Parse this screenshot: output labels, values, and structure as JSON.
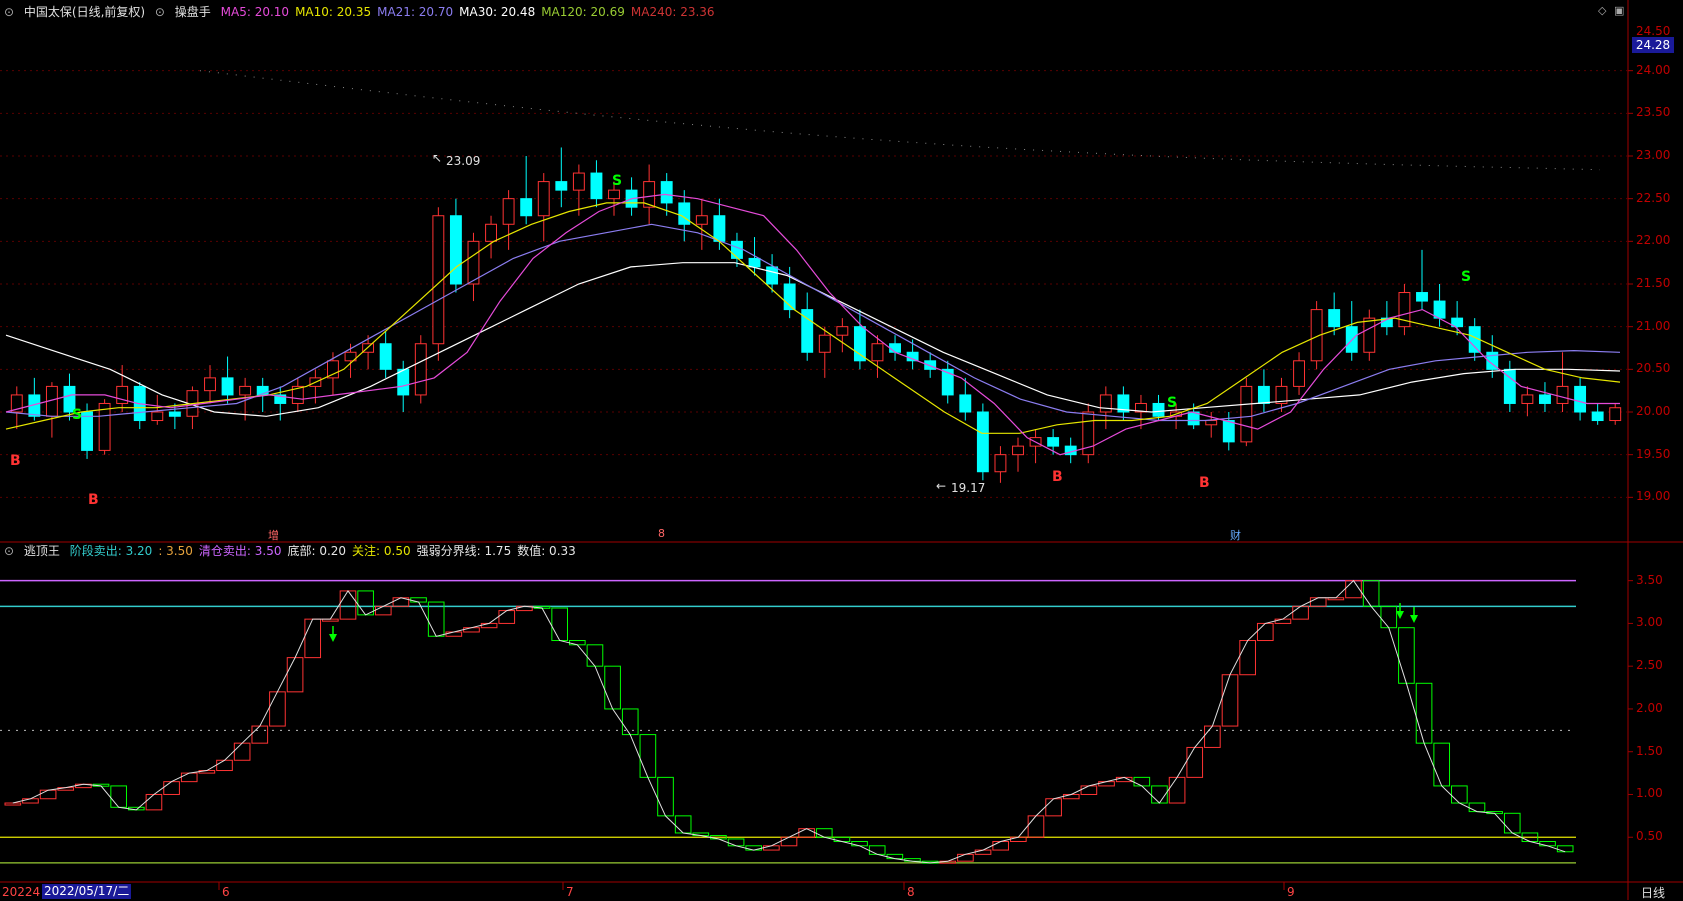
{
  "colors": {
    "up": "#ff3333",
    "down": "#00ffff",
    "green": "#00ff00",
    "grid": "#5a0000",
    "axis": "#a00000",
    "ma5": "#e54bd9",
    "ma10": "#e6e600",
    "ma21": "#8b7df0",
    "ma30": "#ffffff",
    "ma120": "#99cc33",
    "ma240": "#cc3333",
    "purple_line": "#cc66ff",
    "cyan_line": "#33cccc",
    "yellow_line": "#e6e600"
  },
  "header": {
    "icon": "collapse-icon",
    "title": "中国太保(日线,前复权)",
    "indicator_icon": "collapse-icon",
    "indicator_name": "操盘手",
    "ma": [
      {
        "label": "MA5: 20.10",
        "color": "#e54bd9"
      },
      {
        "label": "MA10: 20.35",
        "color": "#e6e600"
      },
      {
        "label": "MA21: 20.70",
        "color": "#8b7df0"
      },
      {
        "label": "MA30: 20.48",
        "color": "#ffffff"
      },
      {
        "label": "MA120: 20.69",
        "color": "#99cc33"
      },
      {
        "label": "MA240: 23.36",
        "color": "#cc3333"
      }
    ]
  },
  "sub_header": {
    "name": "逃顶王",
    "items": [
      {
        "label": "阶段卖出: 3.20",
        "color": "#33cccc"
      },
      {
        "label": ": 3.50",
        "color": "#e6a23c"
      },
      {
        "label": "清仓卖出: 3.50",
        "color": "#cc66ff"
      },
      {
        "label": "底部: 0.20",
        "color": "#e6e6e6"
      },
      {
        "label": "关注: 0.50",
        "color": "#e6e600"
      },
      {
        "label": "强弱分界线: 1.75",
        "color": "#e6e6e6"
      },
      {
        "label": "数值: 0.33",
        "color": "#e6e6e6"
      }
    ]
  },
  "price_axis": {
    "current": "24.28",
    "top_label": "24.50",
    "ticks": [
      "24.00",
      "23.50",
      "23.00",
      "22.50",
      "22.00",
      "21.50",
      "21.00",
      "20.50",
      "20.00",
      "19.50",
      "19.00"
    ]
  },
  "indicator_axis": {
    "ticks": [
      "3.50",
      "3.00",
      "2.50",
      "2.00",
      "1.50",
      "1.00",
      "0.50"
    ]
  },
  "annotations": {
    "high": "23.09",
    "low": "19.17"
  },
  "signals": [
    {
      "text": "B",
      "x": 10,
      "y": 462,
      "color": "#ff3333"
    },
    {
      "text": "B",
      "x": 88,
      "y": 501,
      "color": "#ff3333"
    },
    {
      "text": "S",
      "x": 72,
      "y": 416,
      "color": "#00ff00"
    },
    {
      "text": "S",
      "x": 612,
      "y": 182,
      "color": "#00ff00"
    },
    {
      "text": "B",
      "x": 1052,
      "y": 478,
      "color": "#ff3333"
    },
    {
      "text": "S",
      "x": 1167,
      "y": 404,
      "color": "#00ff00"
    },
    {
      "text": "B",
      "x": 1199,
      "y": 484,
      "color": "#ff3333"
    },
    {
      "text": "S",
      "x": 1461,
      "y": 278,
      "color": "#00ff00"
    }
  ],
  "events": [
    {
      "text": "增",
      "x": 268
    },
    {
      "text": "8",
      "x": 658
    },
    {
      "text": "财",
      "x": 1230
    }
  ],
  "time_axis": {
    "start": "20224",
    "cursor": "2022/05/17/二",
    "months": [
      {
        "text": "6",
        "x": 222
      },
      {
        "text": "7",
        "x": 566
      },
      {
        "text": "8",
        "x": 907
      },
      {
        "text": "9",
        "x": 1287
      }
    ]
  },
  "footer": {
    "period": "日线"
  },
  "chart_data": {
    "type": "candlestick",
    "x_months": [
      "6",
      "7",
      "8",
      "9"
    ],
    "ylim": [
      18.5,
      24.5
    ],
    "candles_ohlc": [
      [
        20.0,
        20.3,
        19.8,
        20.2
      ],
      [
        20.2,
        20.4,
        19.9,
        19.95
      ],
      [
        19.95,
        20.35,
        19.7,
        20.3
      ],
      [
        20.3,
        20.45,
        19.9,
        20.0
      ],
      [
        20.0,
        20.1,
        19.45,
        19.55
      ],
      [
        19.55,
        20.15,
        19.5,
        20.1
      ],
      [
        20.1,
        20.55,
        20.0,
        20.3
      ],
      [
        20.3,
        20.35,
        19.8,
        19.9
      ],
      [
        19.9,
        20.2,
        19.85,
        20.0
      ],
      [
        20.0,
        20.1,
        19.8,
        19.95
      ],
      [
        19.95,
        20.3,
        19.8,
        20.25
      ],
      [
        20.25,
        20.55,
        20.1,
        20.4
      ],
      [
        20.4,
        20.65,
        20.1,
        20.2
      ],
      [
        20.2,
        20.4,
        19.9,
        20.3
      ],
      [
        20.3,
        20.4,
        20.0,
        20.2
      ],
      [
        20.2,
        20.3,
        19.9,
        20.1
      ],
      [
        20.1,
        20.4,
        20.0,
        20.3
      ],
      [
        20.3,
        20.5,
        20.1,
        20.4
      ],
      [
        20.4,
        20.7,
        20.2,
        20.6
      ],
      [
        20.6,
        20.8,
        20.4,
        20.7
      ],
      [
        20.7,
        20.9,
        20.5,
        20.8
      ],
      [
        20.8,
        20.95,
        20.4,
        20.5
      ],
      [
        20.5,
        20.6,
        20.0,
        20.2
      ],
      [
        20.2,
        20.9,
        20.1,
        20.8
      ],
      [
        20.8,
        22.4,
        20.6,
        22.3
      ],
      [
        22.3,
        22.5,
        21.4,
        21.5
      ],
      [
        21.5,
        22.1,
        21.3,
        22.0
      ],
      [
        22.0,
        22.3,
        21.8,
        22.2
      ],
      [
        22.2,
        22.6,
        21.9,
        22.5
      ],
      [
        22.5,
        23.0,
        22.2,
        22.3
      ],
      [
        22.3,
        22.8,
        22.0,
        22.7
      ],
      [
        22.7,
        23.1,
        22.4,
        22.6
      ],
      [
        22.6,
        22.9,
        22.3,
        22.8
      ],
      [
        22.8,
        22.95,
        22.4,
        22.5
      ],
      [
        22.5,
        22.7,
        22.3,
        22.6
      ],
      [
        22.6,
        22.75,
        22.3,
        22.4
      ],
      [
        22.4,
        22.9,
        22.2,
        22.7
      ],
      [
        22.7,
        22.8,
        22.3,
        22.45
      ],
      [
        22.45,
        22.6,
        22.0,
        22.2
      ],
      [
        22.2,
        22.5,
        21.9,
        22.3
      ],
      [
        22.3,
        22.5,
        21.9,
        22.0
      ],
      [
        22.0,
        22.1,
        21.7,
        21.8
      ],
      [
        21.8,
        22.05,
        21.6,
        21.7
      ],
      [
        21.7,
        21.85,
        21.4,
        21.5
      ],
      [
        21.5,
        21.7,
        21.1,
        21.2
      ],
      [
        21.2,
        21.4,
        20.6,
        20.7
      ],
      [
        20.7,
        21.0,
        20.4,
        20.9
      ],
      [
        20.9,
        21.1,
        20.7,
        21.0
      ],
      [
        21.0,
        21.2,
        20.5,
        20.6
      ],
      [
        20.6,
        20.9,
        20.4,
        20.8
      ],
      [
        20.8,
        20.9,
        20.6,
        20.7
      ],
      [
        20.7,
        20.85,
        20.5,
        20.6
      ],
      [
        20.6,
        20.7,
        20.4,
        20.5
      ],
      [
        20.5,
        20.6,
        20.1,
        20.2
      ],
      [
        20.2,
        20.4,
        19.9,
        20.0
      ],
      [
        20.0,
        20.1,
        19.2,
        19.3
      ],
      [
        19.3,
        19.6,
        19.17,
        19.5
      ],
      [
        19.5,
        19.7,
        19.3,
        19.6
      ],
      [
        19.6,
        19.8,
        19.4,
        19.7
      ],
      [
        19.7,
        19.8,
        19.5,
        19.6
      ],
      [
        19.6,
        19.7,
        19.4,
        19.5
      ],
      [
        19.5,
        20.1,
        19.4,
        20.0
      ],
      [
        20.0,
        20.3,
        19.8,
        20.2
      ],
      [
        20.2,
        20.3,
        19.9,
        20.0
      ],
      [
        20.0,
        20.2,
        19.8,
        20.1
      ],
      [
        20.1,
        20.2,
        19.9,
        19.95
      ],
      [
        19.95,
        20.1,
        19.8,
        20.0
      ],
      [
        20.0,
        20.1,
        19.8,
        19.85
      ],
      [
        19.85,
        20.0,
        19.7,
        19.9
      ],
      [
        19.9,
        20.0,
        19.55,
        19.65
      ],
      [
        19.65,
        20.4,
        19.6,
        20.3
      ],
      [
        20.3,
        20.5,
        20.0,
        20.1
      ],
      [
        20.1,
        20.4,
        20.0,
        20.3
      ],
      [
        20.3,
        20.7,
        20.2,
        20.6
      ],
      [
        20.6,
        21.3,
        20.5,
        21.2
      ],
      [
        21.2,
        21.4,
        20.9,
        21.0
      ],
      [
        21.0,
        21.3,
        20.6,
        20.7
      ],
      [
        20.7,
        21.2,
        20.6,
        21.1
      ],
      [
        21.1,
        21.3,
        20.9,
        21.0
      ],
      [
        21.0,
        21.5,
        20.9,
        21.4
      ],
      [
        21.4,
        21.9,
        21.2,
        21.3
      ],
      [
        21.3,
        21.5,
        21.0,
        21.1
      ],
      [
        21.1,
        21.3,
        20.9,
        21.0
      ],
      [
        21.0,
        21.1,
        20.6,
        20.7
      ],
      [
        20.7,
        20.9,
        20.4,
        20.5
      ],
      [
        20.5,
        20.6,
        20.0,
        20.1
      ],
      [
        20.1,
        20.3,
        19.95,
        20.2
      ],
      [
        20.2,
        20.35,
        20.0,
        20.1
      ],
      [
        20.1,
        20.7,
        20.0,
        20.3
      ],
      [
        20.3,
        20.4,
        19.9,
        20.0
      ],
      [
        20.0,
        20.1,
        19.85,
        19.9
      ],
      [
        19.9,
        20.1,
        19.85,
        20.05
      ]
    ],
    "indicator_values": [
      0.9,
      0.95,
      1.05,
      1.08,
      1.12,
      1.1,
      0.85,
      0.82,
      1.0,
      1.15,
      1.25,
      1.28,
      1.4,
      1.6,
      1.8,
      2.2,
      2.6,
      3.05,
      3.05,
      3.38,
      3.1,
      3.2,
      3.3,
      3.25,
      2.85,
      2.9,
      2.95,
      3.0,
      3.15,
      3.2,
      3.18,
      2.8,
      2.75,
      2.5,
      2.0,
      1.7,
      1.2,
      0.75,
      0.55,
      0.52,
      0.48,
      0.4,
      0.35,
      0.4,
      0.5,
      0.6,
      0.5,
      0.45,
      0.4,
      0.3,
      0.25,
      0.22,
      0.2,
      0.22,
      0.3,
      0.35,
      0.45,
      0.5,
      0.75,
      0.95,
      1.0,
      1.1,
      1.15,
      1.2,
      1.1,
      0.9,
      1.2,
      1.55,
      1.8,
      2.4,
      2.8,
      3.0,
      3.05,
      3.2,
      3.3,
      3.3,
      3.5,
      3.2,
      2.95,
      2.3,
      1.6,
      1.1,
      0.9,
      0.8,
      0.78,
      0.55,
      0.45,
      0.4,
      0.33
    ],
    "ma_series": [
      {
        "name": "MA5",
        "values": [
          20.0,
          20.1,
          20.2,
          20.2,
          20.1,
          20.05,
          20.1,
          20.15,
          20.2,
          20.15,
          20.2,
          20.25,
          20.3,
          20.4,
          20.7,
          21.3,
          21.8,
          22.1,
          22.35,
          22.5,
          22.55,
          22.5,
          22.4,
          22.3,
          21.9,
          21.4,
          21.0,
          20.7,
          20.55,
          20.4,
          20.1,
          19.7,
          19.5,
          19.6,
          19.8,
          19.9,
          20.0,
          19.9,
          19.8,
          20.0,
          20.5,
          20.9,
          21.1,
          21.2,
          21.0,
          20.6,
          20.3,
          20.2,
          20.1,
          20.1
        ]
      },
      {
        "name": "MA10",
        "values": [
          19.8,
          19.9,
          20.0,
          20.05,
          20.05,
          20.1,
          20.15,
          20.2,
          20.3,
          20.5,
          20.9,
          21.3,
          21.7,
          22.0,
          22.2,
          22.35,
          22.45,
          22.45,
          22.3,
          22.0,
          21.6,
          21.2,
          20.9,
          20.6,
          20.3,
          20.0,
          19.75,
          19.75,
          19.85,
          19.9,
          19.9,
          19.95,
          20.1,
          20.4,
          20.7,
          20.9,
          21.05,
          21.1,
          21.0,
          20.9,
          20.7,
          20.5,
          20.4,
          20.35
        ]
      },
      {
        "name": "MA21",
        "values": [
          20.0,
          19.95,
          19.95,
          20.0,
          20.05,
          20.1,
          20.3,
          20.6,
          20.9,
          21.2,
          21.5,
          21.8,
          22.0,
          22.1,
          22.2,
          22.1,
          21.9,
          21.6,
          21.3,
          21.0,
          20.7,
          20.4,
          20.15,
          20.0,
          19.95,
          19.9,
          19.9,
          19.95,
          20.1,
          20.3,
          20.5,
          20.6,
          20.65,
          20.7,
          20.72,
          20.7
        ]
      },
      {
        "name": "MA30",
        "values": [
          20.9,
          20.7,
          20.5,
          20.2,
          20.0,
          19.95,
          20.05,
          20.3,
          20.6,
          20.9,
          21.2,
          21.5,
          21.7,
          21.75,
          21.75,
          21.6,
          21.3,
          21.0,
          20.7,
          20.45,
          20.2,
          20.05,
          20.0,
          20.05,
          20.1,
          20.15,
          20.2,
          20.35,
          20.45,
          20.5,
          20.5,
          20.48
        ]
      }
    ]
  }
}
